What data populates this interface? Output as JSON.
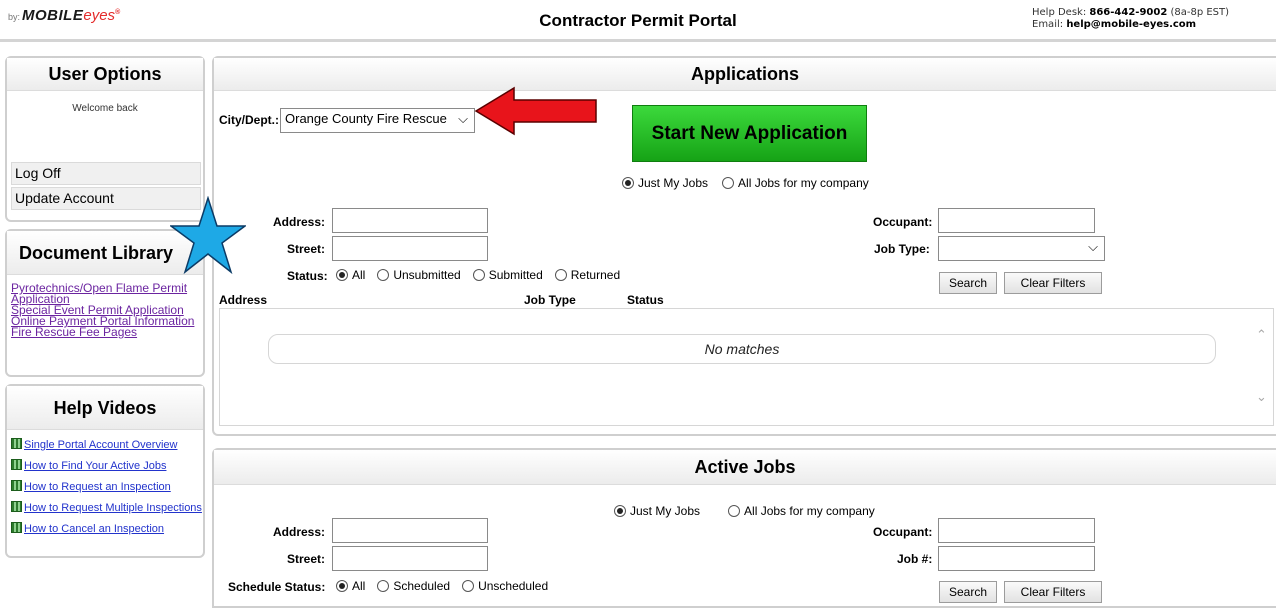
{
  "header": {
    "logo": {
      "by": "by:",
      "brand_main": "MOBILE",
      "brand_accent": "eyes",
      "mark": "®"
    },
    "title": "Contractor Permit Portal",
    "helpdesk_label": "Help Desk:",
    "helpdesk_phone": "866-442-9002",
    "helpdesk_hours": "(8a-8p EST)",
    "email_label": "Email:",
    "email": "help@mobile-eyes.com"
  },
  "user_options": {
    "title": "User Options",
    "welcome": "Welcome back",
    "items": [
      {
        "label": "Log Off"
      },
      {
        "label": "Update Account"
      }
    ]
  },
  "document_library": {
    "title": "Document Library",
    "links": [
      {
        "label": "Pyrotechnics/Open Flame Permit Application"
      },
      {
        "label": "Special Event Permit Application"
      },
      {
        "label": "Online Payment Portal Information"
      },
      {
        "label": "Fire Rescue Fee Pages"
      }
    ]
  },
  "help_videos": {
    "title": "Help Videos",
    "links": [
      {
        "label": "Single Portal Account Overview"
      },
      {
        "label": "How to Find Your Active Jobs"
      },
      {
        "label": "How to Request an Inspection"
      },
      {
        "label": "How to Request Multiple Inspections"
      },
      {
        "label": "How to Cancel an Inspection"
      }
    ]
  },
  "applications": {
    "title": "Applications",
    "city_label": "City/Dept.:",
    "city_value": "Orange County Fire Rescue",
    "start_button": "Start New Application",
    "scope_options": [
      "Just My Jobs",
      "All Jobs for my company"
    ],
    "scope_selected": "Just My Jobs",
    "address_label": "Address:",
    "address_value": "",
    "street_label": "Street:",
    "street_value": "",
    "status_label": "Status:",
    "status_options": [
      "All",
      "Unsubmitted",
      "Submitted",
      "Returned"
    ],
    "status_selected": "All",
    "occupant_label": "Occupant:",
    "occupant_value": "",
    "jobtype_label": "Job Type:",
    "jobtype_value": "",
    "search_button": "Search",
    "clear_button": "Clear Filters",
    "columns": [
      "Address",
      "Job Type",
      "Status"
    ],
    "empty_text": "No matches"
  },
  "active_jobs": {
    "title": "Active Jobs",
    "scope_options": [
      "Just My Jobs",
      "All Jobs for my company"
    ],
    "scope_selected": "Just My Jobs",
    "address_label": "Address:",
    "address_value": "",
    "street_label": "Street:",
    "street_value": "",
    "schedule_label": "Schedule Status:",
    "schedule_options": [
      "All",
      "Scheduled",
      "Unscheduled"
    ],
    "schedule_selected": "All",
    "occupant_label": "Occupant:",
    "occupant_value": "",
    "jobnum_label": "Job #:",
    "jobnum_value": "",
    "search_button": "Search",
    "clear_button": "Clear Filters"
  },
  "annotations": {
    "arrow_color": "#e8141b",
    "star_color": "#1ea9e6"
  }
}
